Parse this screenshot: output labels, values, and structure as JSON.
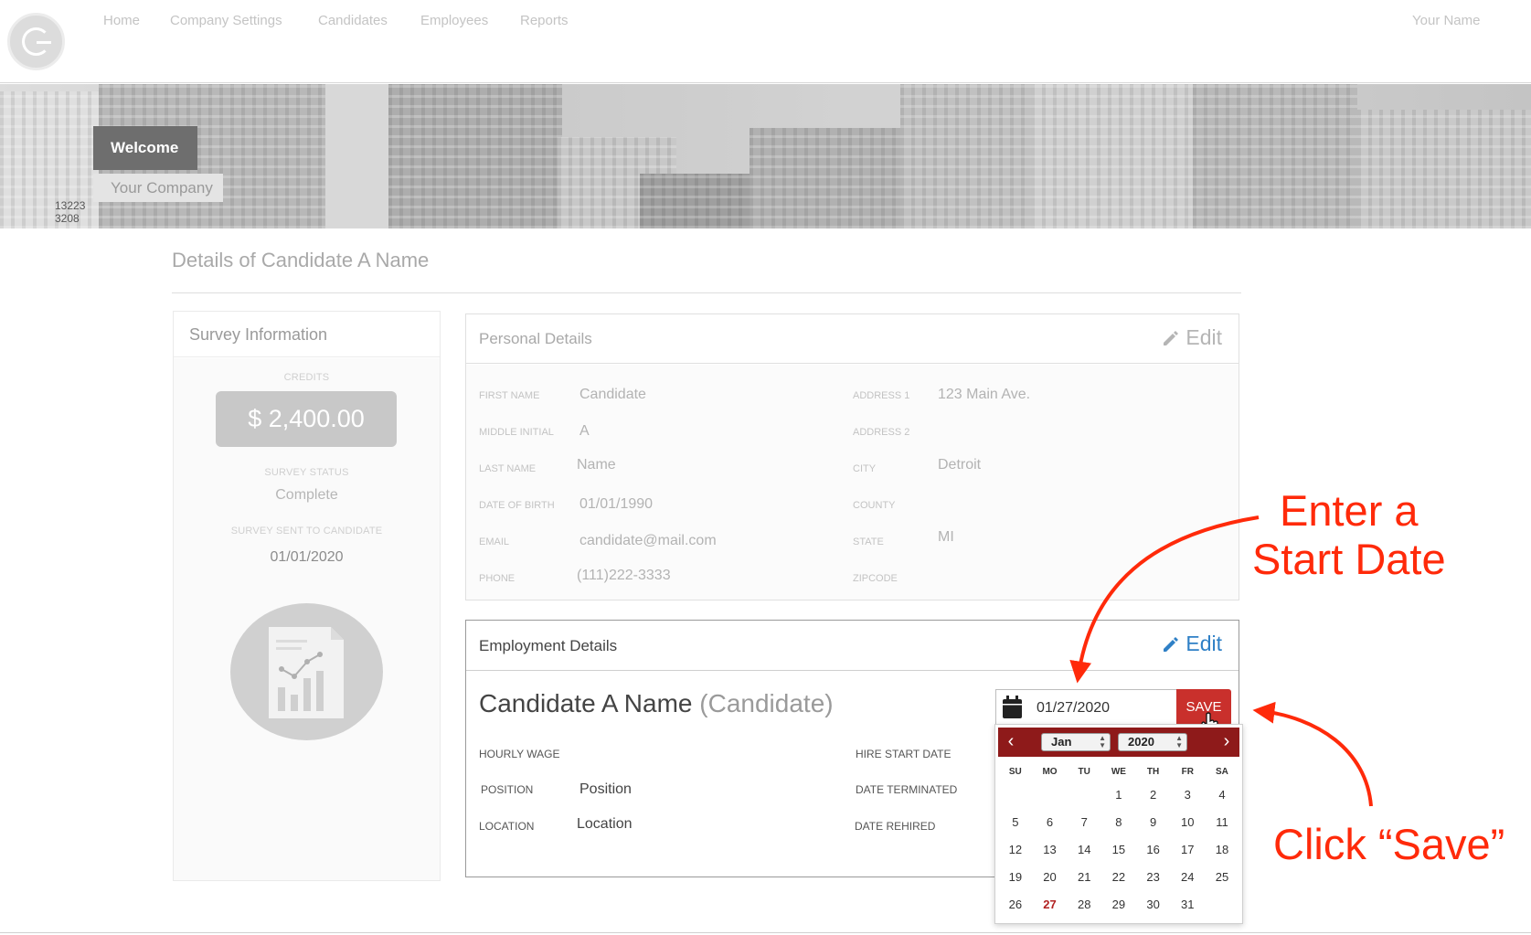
{
  "nav": {
    "items": [
      "Home",
      "Company Settings",
      "Candidates",
      "Employees",
      "Reports"
    ],
    "user_name": "Your Name"
  },
  "hero": {
    "welcome": "Welcome",
    "company": "Your Company",
    "sign_number_1": "13223",
    "sign_number_2": "3208"
  },
  "page": {
    "title": "Details of Candidate A Name"
  },
  "survey": {
    "title": "Survey Information",
    "credits_label": "CREDITS",
    "credits_value": "$ 2,400.00",
    "status_label": "SURVEY STATUS",
    "status_value": "Complete",
    "sent_label": "SURVEY SENT TO CANDIDATE",
    "sent_value": "01/01/2020",
    "icon": "report-chart-icon"
  },
  "personal": {
    "title": "Personal Details",
    "edit_label": "Edit",
    "first_name_label": "FIRST NAME",
    "first_name": "Candidate",
    "middle_initial_label": "MIDDLE INITIAL",
    "middle_initial": "A",
    "last_name_label": "LAST NAME",
    "last_name": "Name",
    "dob_label": "DATE OF BIRTH",
    "dob": "01/01/1990",
    "email_label": "EMAIL",
    "email": "candidate@mail.com",
    "phone_label": "PHONE",
    "phone": "(111)222-3333",
    "address1_label": "ADDRESS 1",
    "address1": "123 Main Ave.",
    "address2_label": "ADDRESS 2",
    "address2": "",
    "city_label": "CITY",
    "city": "Detroit",
    "county_label": "COUNTY",
    "county": "",
    "state_label": "STATE",
    "state": "MI",
    "zipcode_label": "ZIPCODE",
    "zipcode": ""
  },
  "employment": {
    "title": "Employment Details",
    "edit_label": "Edit",
    "candidate_name": "Candidate A Name",
    "candidate_role": "(Candidate)",
    "hourly_wage_label": "HOURLY WAGE",
    "position_label": "POSITION",
    "position": "Position",
    "location_label": "LOCATION",
    "location": "Location",
    "hire_start_label": "HIRE START DATE",
    "terminated_label": "DATE TERMINATED",
    "rehired_label": "DATE REHIRED"
  },
  "datepicker": {
    "value": "01/27/2020",
    "save_label": "SAVE",
    "month": "Jan",
    "year": "2020",
    "weekdays": [
      "SU",
      "MO",
      "TU",
      "WE",
      "TH",
      "FR",
      "SA"
    ],
    "weeks": [
      [
        "",
        "",
        "",
        "1",
        "2",
        "3",
        "4"
      ],
      [
        "5",
        "6",
        "7",
        "8",
        "9",
        "10",
        "11"
      ],
      [
        "12",
        "13",
        "14",
        "15",
        "16",
        "17",
        "18"
      ],
      [
        "19",
        "20",
        "21",
        "22",
        "23",
        "24",
        "25"
      ],
      [
        "26",
        "27",
        "28",
        "29",
        "30",
        "31",
        ""
      ]
    ],
    "selected_day": "27"
  },
  "annotations": {
    "enter_line1": "Enter a",
    "enter_line2": "Start Date",
    "click_save": "Click “Save”",
    "color": "#ff2a0a"
  },
  "colors": {
    "save_button": "#c9302c",
    "calendar_header": "#8e1a1a",
    "edit_active": "#2f80c6"
  }
}
